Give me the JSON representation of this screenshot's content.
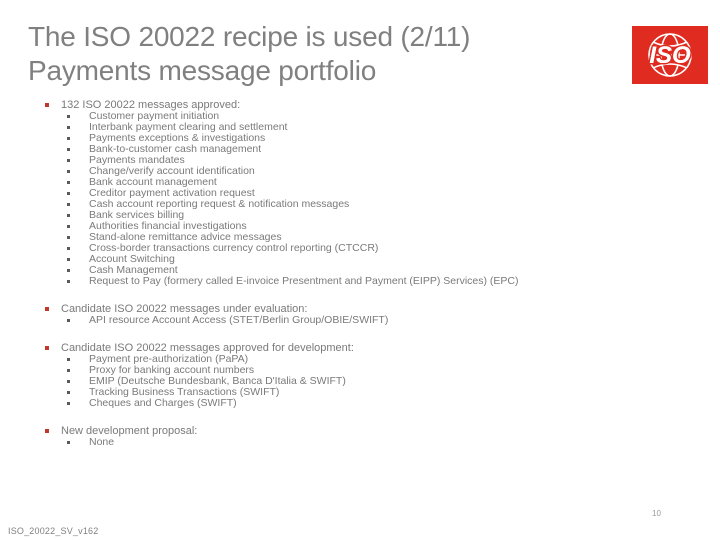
{
  "slide": {
    "title_lines": [
      "The ISO 20022 recipe is used (2/11)",
      "Payments message portfolio"
    ],
    "logo_alt": "ISO",
    "footer_id": "ISO_20022_SV_v162",
    "page_number": "10",
    "accent_color": "#e02b20",
    "bullet_color": "#c0392b",
    "text_color": "#7a7a7a"
  },
  "sections": [
    {
      "heading": "132 ISO 20022 messages approved:",
      "items": [
        "Customer payment initiation",
        "Interbank payment clearing and settlement",
        "Payments exceptions & investigations",
        "Bank-to-customer cash management",
        "Payments mandates",
        "Change/verify account identification",
        "Bank account management",
        "Creditor payment activation request",
        "Cash account reporting request & notification messages",
        "Bank services billing",
        "Authorities financial investigations",
        "Stand-alone remittance advice messages",
        "Cross-border transactions currency control  reporting (CTCCR)",
        "Account Switching",
        "Cash Management",
        "Request to Pay (formery called E-invoice Presentment and Payment (EIPP) Services) (EPC)"
      ]
    },
    {
      "heading": "Candidate ISO 20022 messages under evaluation:",
      "items": [
        "API resource Account Access (STET/Berlin Group/OBIE/SWIFT)"
      ]
    },
    {
      "heading": "Candidate ISO 20022 messages approved for development:",
      "items": [
        "Payment pre-authorization (PaPA)",
        "Proxy for banking account numbers",
        "EMIP (Deutsche Bundesbank, Banca D'Italia & SWIFT)",
        "Tracking Business Transactions (SWIFT)",
        "Cheques and Charges (SWIFT)"
      ]
    },
    {
      "heading": "New development proposal:",
      "items": [
        "None"
      ]
    }
  ]
}
